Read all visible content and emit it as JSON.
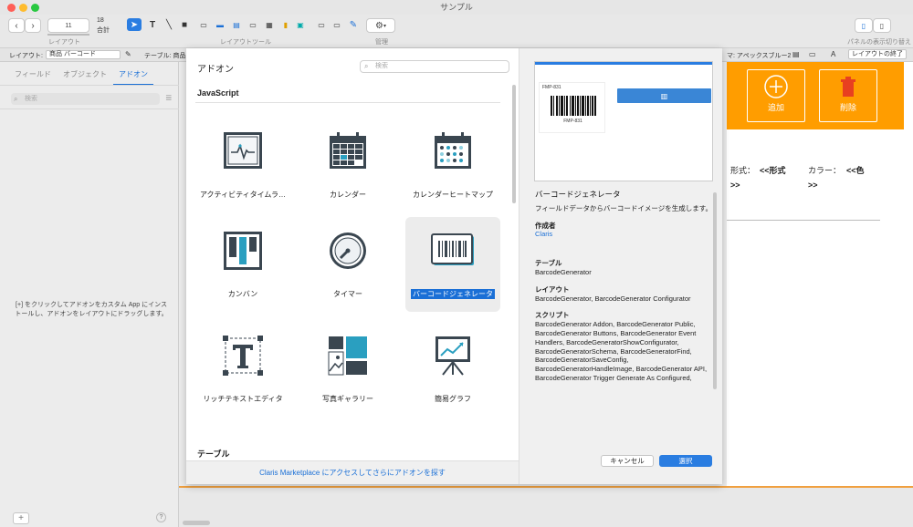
{
  "window": {
    "title": "サンプル"
  },
  "toolbar": {
    "zoom_value": "11",
    "count_value": "18",
    "count_label": "合計",
    "layout_group_label": "レイアウト",
    "layout_tools_label": "レイアウトツール",
    "manage_label": "管理",
    "panel_toggle_label": "パネルの表示切り替え"
  },
  "layoutbar": {
    "layout_label": "レイアウト:",
    "layout_value": "商品 バーコード",
    "table_label": "テーブル: 商品",
    "theme_label": "マ: アペックスブルー2",
    "exit_button": "レイアウトの終了"
  },
  "leftpanel": {
    "tabs": [
      "フィールド",
      "オブジェクト",
      "アドオン"
    ],
    "search_placeholder": "検索",
    "hint": "[+] をクリックしてアドオンをカスタム App にインストールし、アドオンをレイアウトにドラッグします。",
    "help": "?"
  },
  "dialog": {
    "title": "アドオン",
    "search_placeholder": "検索",
    "section_javascript": "JavaScript",
    "section_table": "テーブル",
    "addons": [
      {
        "label": "アクティビティタイムラ…",
        "icon": "activity-timeline-icon"
      },
      {
        "label": "カレンダー",
        "icon": "calendar-icon"
      },
      {
        "label": "カレンダーヒートマップ",
        "icon": "calendar-heatmap-icon"
      },
      {
        "label": "カンバン",
        "icon": "kanban-icon"
      },
      {
        "label": "タイマー",
        "icon": "timer-icon"
      },
      {
        "label": "バーコードジェネレータ",
        "icon": "barcode-icon"
      },
      {
        "label": "リッチテキストエディタ",
        "icon": "rich-text-icon"
      },
      {
        "label": "写真ギャラリー",
        "icon": "photo-gallery-icon"
      },
      {
        "label": "簡易グラフ",
        "icon": "simple-chart-icon"
      }
    ],
    "marketplace_link": "Claris Marketplace にアクセスしてさらにアドオンを探す",
    "preview_label": "FMP-831",
    "preview_code": "FMP-831",
    "detail": {
      "name": "バーコードジェネレータ",
      "description": "フィールドデータからバーコードイメージを生成します。",
      "author_label": "作成者",
      "author": "Claris",
      "table_label": "テーブル",
      "table": "BarcodeGenerator",
      "layout_label": "レイアウト",
      "layout": "BarcodeGenerator, BarcodeGenerator Configurator",
      "script_label": "スクリプト",
      "scripts": "BarcodeGenerator Addon, BarcodeGenerator Public, BarcodeGenerator Buttons, BarcodeGenerator Event Handlers, BarcodeGeneratorShowConfigurator, BarcodeGeneratorSchema, BarcodeGeneratorFind, BarcodeGeneratorSaveConfig, BarcodeGeneratorHandleImage, BarcodeGenerator API, BarcodeGenerator Trigger Generate As Configured,"
    },
    "cancel": "キャンセル",
    "select": "選択"
  },
  "canvas": {
    "add_label": "追加",
    "delete_label": "削除",
    "format_label": "形式：",
    "format_value": "<<形式",
    "format_cont": ">>",
    "color_label": "カラー：",
    "color_value": "<<色",
    "color_cont": ">>"
  },
  "colors": {
    "accent": "#1a6fd6",
    "orange": "#ff9d00",
    "icon_dark": "#3a4650",
    "icon_teal": "#2a9fc0"
  }
}
